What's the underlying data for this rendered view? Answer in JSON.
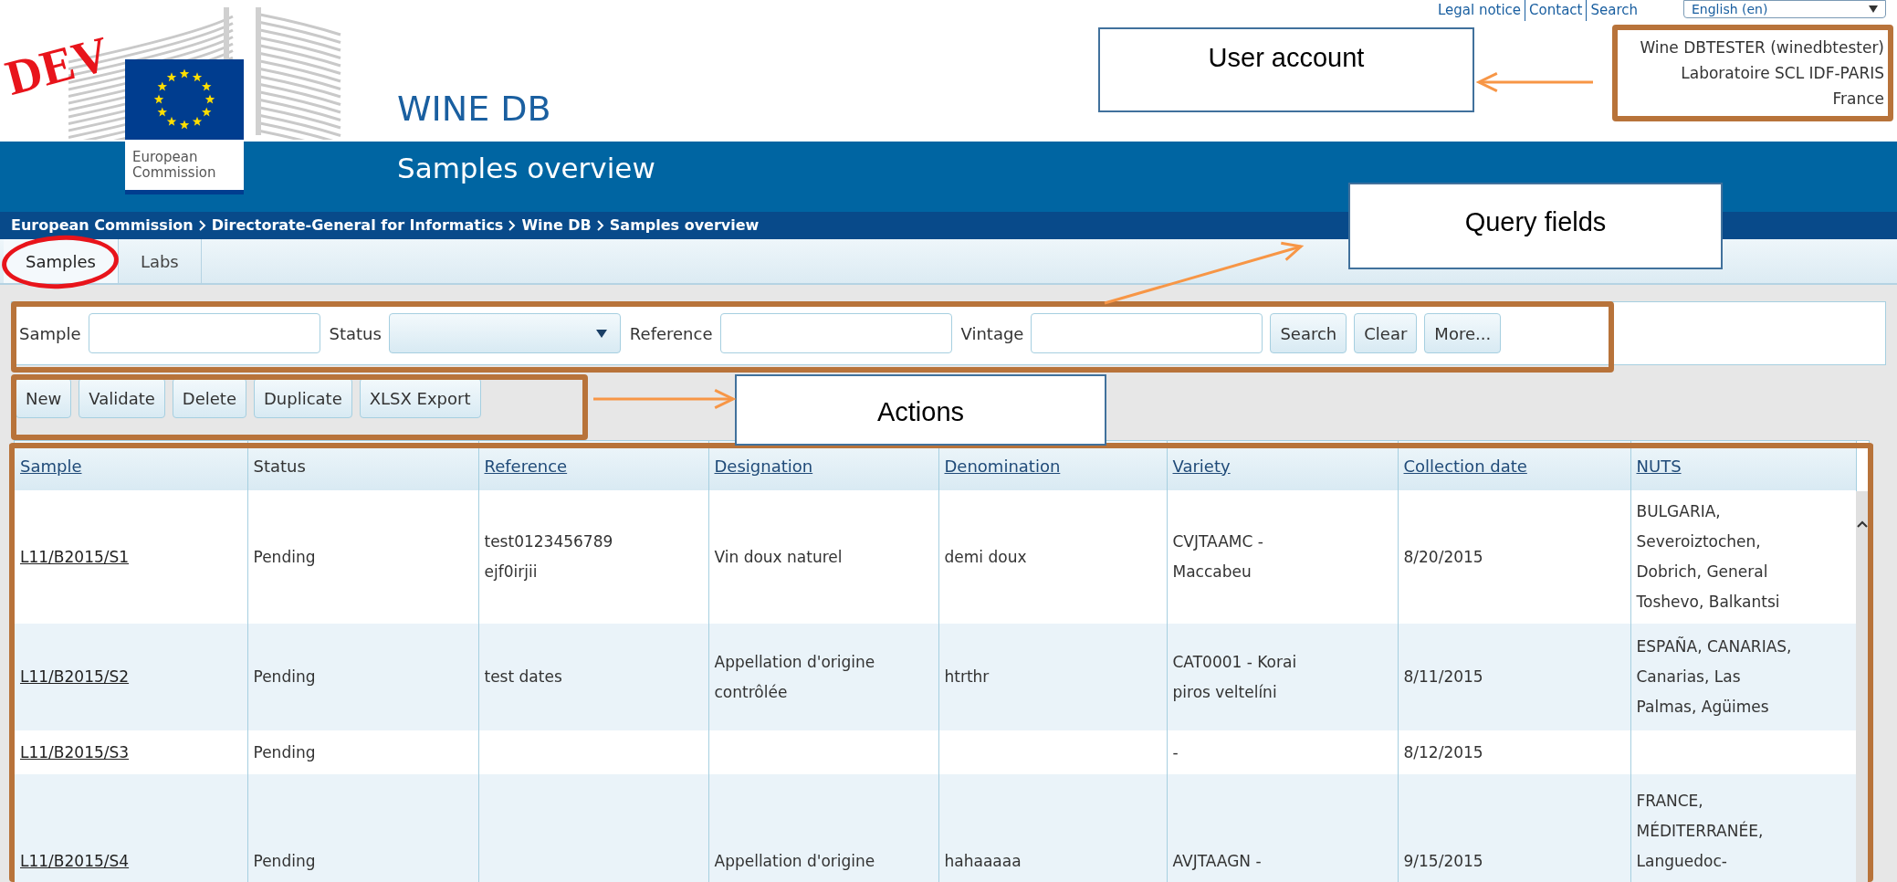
{
  "top_links": [
    {
      "label": "Legal notice"
    },
    {
      "label": "Contact"
    },
    {
      "label": "Search"
    }
  ],
  "language_select": {
    "value": "English (en)"
  },
  "logo": {
    "caption_lines": [
      "European",
      "Commission"
    ]
  },
  "site_title": "WINE DB",
  "page_title": "Samples overview",
  "user_account": [
    "Wine DBTESTER (winedbtester)",
    "Laboratoire SCL IDF-PARIS",
    "France"
  ],
  "breadcrumb": [
    "European Commission",
    "Directorate-General for Informatics",
    "Wine DB",
    "Samples overview"
  ],
  "tabs": [
    {
      "label": "Samples",
      "selected": true
    },
    {
      "label": "Labs",
      "selected": false
    }
  ],
  "query": {
    "fields": [
      {
        "kind": "text",
        "label": "Sample"
      },
      {
        "kind": "select",
        "label": "Status"
      },
      {
        "kind": "text",
        "label": "Reference"
      },
      {
        "kind": "text",
        "label": "Vintage"
      }
    ],
    "buttons": [
      "Search",
      "Clear",
      "More..."
    ]
  },
  "actions": [
    "New",
    "Validate",
    "Delete",
    "Duplicate",
    "XLSX Export"
  ],
  "table": {
    "columns": [
      {
        "label": "Sample",
        "sortable": true
      },
      {
        "label": "Status",
        "sortable": false
      },
      {
        "label": "Reference",
        "sortable": true
      },
      {
        "label": "Designation",
        "sortable": true
      },
      {
        "label": "Denomination",
        "sortable": true
      },
      {
        "label": "Variety",
        "sortable": true
      },
      {
        "label": "Collection date",
        "sortable": true
      },
      {
        "label": "NUTS",
        "sortable": true
      }
    ],
    "rows": [
      {
        "cells": [
          "L11/B2015/S1",
          "Pending",
          "test0123456789\nejf0irjii",
          "Vin doux naturel",
          "demi doux",
          "CVJTAAMC -\nMaccabeu",
          "8/20/2015",
          "BULGARIA,\nSeveroiztochen,\nDobrich, General\nToshevo, Balkantsi"
        ]
      },
      {
        "cells": [
          "L11/B2015/S2",
          "Pending",
          "test dates",
          "Appellation d'origine\ncontrôlée",
          "htrthr",
          "CAT0001 - Korai\npiros veltelíni",
          "8/11/2015",
          "ESPAÑA, CANARIAS,\nCanarias, Las\nPalmas, Agüimes"
        ]
      },
      {
        "cells": [
          "L11/B2015/S3",
          "Pending",
          "",
          "",
          "",
          "-",
          "8/12/2015",
          ""
        ]
      },
      {
        "cells": [
          "L11/B2015/S4",
          "Pending",
          "",
          "Appellation d'origine",
          "hahaaaaa",
          "AVJTAAGN -",
          "9/15/2015",
          "FRANCE,\nMÉDITERRANÉE,\nLanguedoc-"
        ]
      }
    ]
  },
  "annotations": {
    "stamp": "DEV",
    "callouts": [
      {
        "label": "User account"
      },
      {
        "label": "Query fields"
      },
      {
        "label": "Actions"
      }
    ]
  }
}
